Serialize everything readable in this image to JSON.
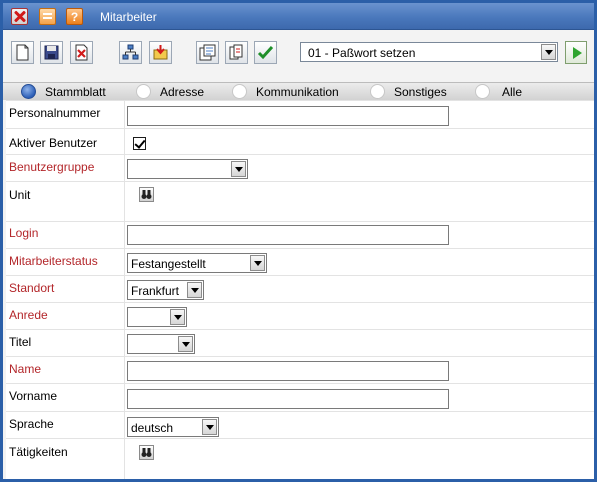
{
  "window": {
    "title": "Mitarbeiter",
    "title_buttons": [
      "close-icon",
      "window-icon",
      "help-icon"
    ],
    "help_glyph": "?"
  },
  "toolbar": {
    "tools": [
      "new-document-icon",
      "save-icon",
      "delete-icon",
      "hierarchy-icon",
      "export-icon",
      "properties-icon",
      "copy-icon",
      "confirm-check-icon"
    ],
    "action_select": {
      "value": "01 - Paßwort setzen"
    },
    "run_button": "play-icon"
  },
  "tabs": [
    {
      "label": "Stammblatt",
      "active": true
    },
    {
      "label": "Adresse",
      "active": false
    },
    {
      "label": "Kommunikation",
      "active": false
    },
    {
      "label": "Sonstiges",
      "active": false
    },
    {
      "label": "Alle",
      "active": false
    }
  ],
  "form": {
    "personalnummer": {
      "label": "Personalnummer",
      "value": ""
    },
    "aktiver_benutzer": {
      "label": "Aktiver Benutzer",
      "checked": true
    },
    "benutzergruppe": {
      "label": "Benutzergruppe",
      "value": ""
    },
    "unit": {
      "label": "Unit"
    },
    "login": {
      "label": "Login",
      "value": ""
    },
    "mitarbeiterstatus": {
      "label": "Mitarbeiterstatus",
      "value": "Festangestellt"
    },
    "standort": {
      "label": "Standort",
      "value": "Frankfurt"
    },
    "anrede": {
      "label": "Anrede",
      "value": ""
    },
    "titel": {
      "label": "Titel",
      "value": ""
    },
    "name": {
      "label": "Name",
      "value": ""
    },
    "vorname": {
      "label": "Vorname",
      "value": ""
    },
    "sprache": {
      "label": "Sprache",
      "value": "deutsch"
    },
    "taetigkeiten": {
      "label": "Tätigkeiten"
    }
  },
  "colors": {
    "titlebar": "#4a78bc",
    "required_label": "#b3262a",
    "window_border": "#2b5fa8"
  }
}
